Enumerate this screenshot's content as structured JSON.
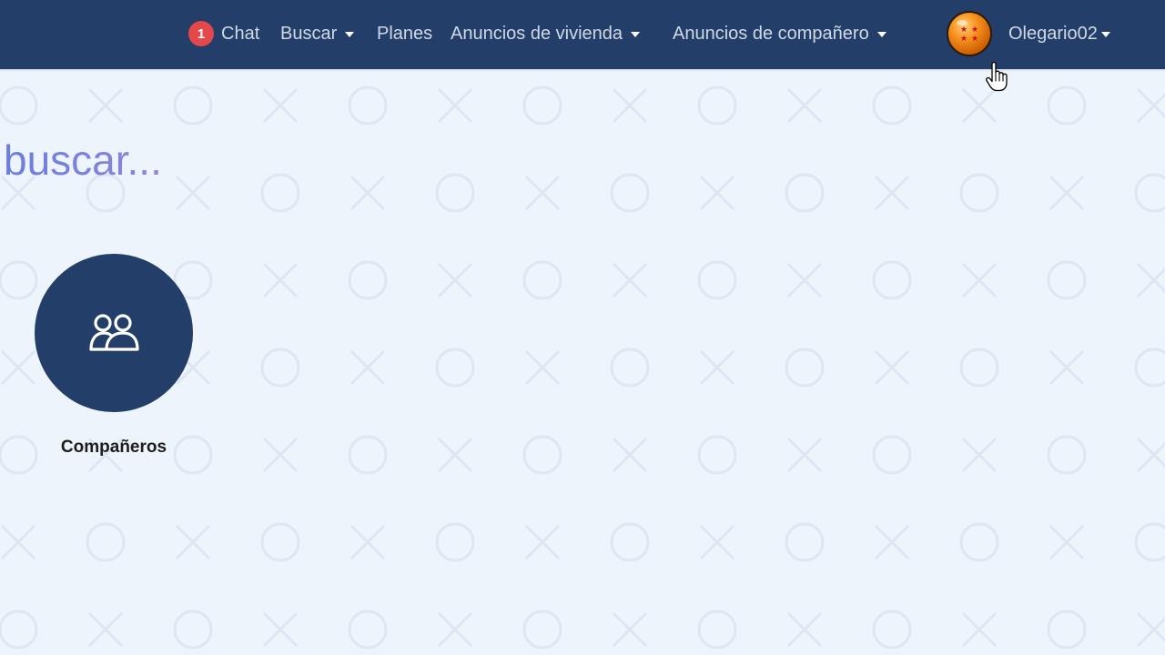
{
  "navbar": {
    "chat": {
      "badge_count": "1",
      "label": "Chat"
    },
    "buscar_label": "Buscar",
    "planes_label": "Planes",
    "anuncios_vivienda_label": "Anuncios de vivienda",
    "anuncios_companero_label": "Anuncios de compañero",
    "user": {
      "avatar_icon": "dragon-ball-avatar-icon",
      "username": "Olegario02"
    }
  },
  "main": {
    "title": "buscar...",
    "cards": [
      {
        "label": "Compañeros",
        "icon": "people-icon"
      }
    ]
  },
  "colors": {
    "navbar_bg": "#233e68",
    "page_bg": "#eef4fc",
    "badge": "#e4484a",
    "title_gradient_start": "#6a7ee0",
    "title_gradient_end": "#8f86d8",
    "avatar": "#f7931e"
  }
}
